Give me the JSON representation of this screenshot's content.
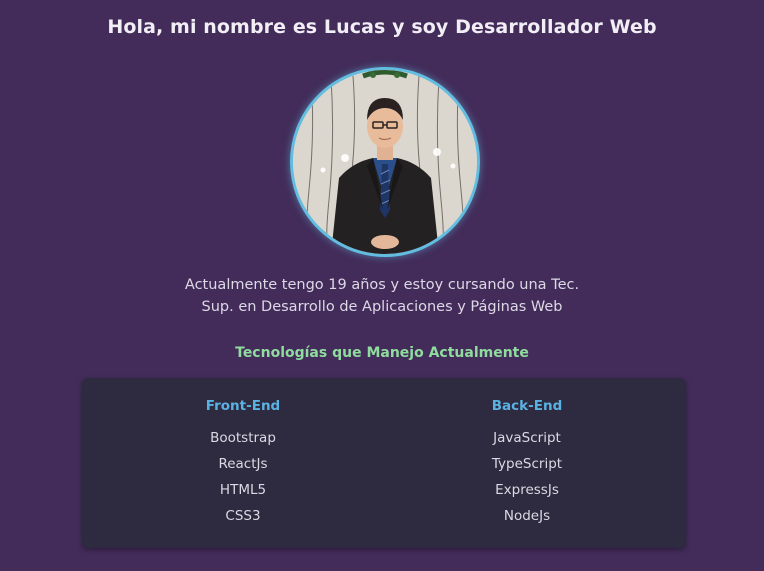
{
  "header": {
    "title": "Hola, mi nombre es Lucas y soy Desarrollador Web"
  },
  "profile": {
    "photo_icon": "profile-photo",
    "bio_line1": "Actualmente tengo 19 años y estoy cursando una Tec.",
    "bio_line2": "Sup. en Desarrollo de Aplicaciones y Páginas Web"
  },
  "technologies": {
    "title": "Tecnologías que Manejo Actualmente",
    "frontend": {
      "title": "Front-End",
      "items": [
        "Bootstrap",
        "ReactJs",
        "HTML5",
        "CSS3"
      ]
    },
    "backend": {
      "title": "Back-End",
      "items": [
        "JavaScript",
        "TypeScript",
        "ExpressJs",
        "NodeJs"
      ]
    }
  },
  "colors": {
    "background": "#432c5a",
    "panel": "#2e2a3f",
    "accent_green": "#8fdc9e",
    "accent_blue": "#5ab2e3",
    "avatar_ring": "#62bde0"
  }
}
